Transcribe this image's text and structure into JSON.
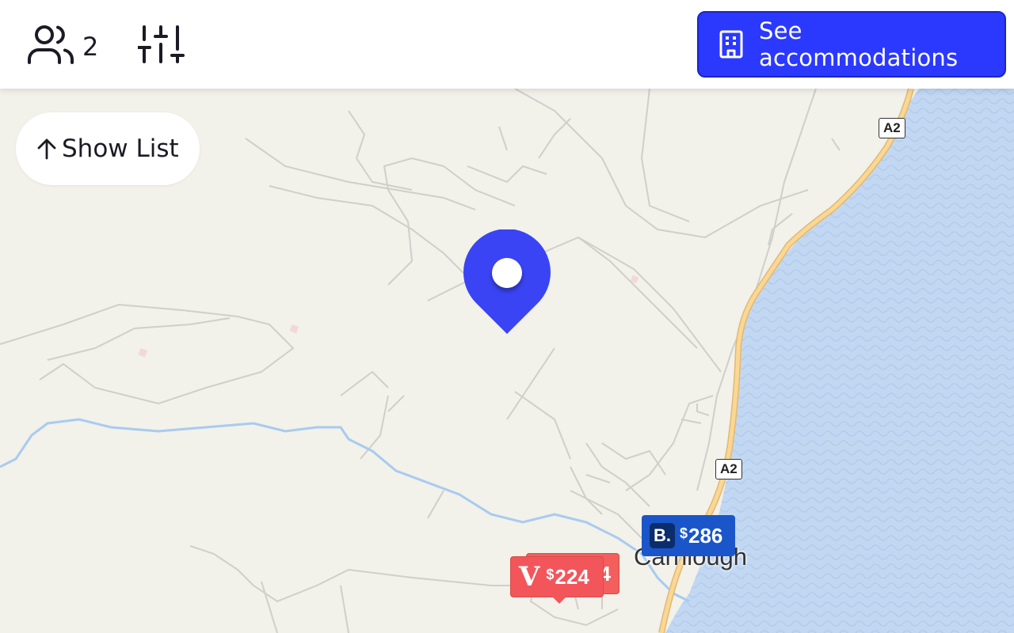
{
  "header": {
    "guests": {
      "icon": "users-icon",
      "count": "2"
    },
    "filters": {
      "icon": "sliders-icon"
    },
    "see_accommodations": {
      "icon": "building-icon",
      "label": "See accommodations"
    }
  },
  "map": {
    "show_list": {
      "icon": "arrow-up-icon",
      "label": "Show List"
    },
    "road_labels": [
      "A2",
      "A2"
    ],
    "place_label": "Carnlough",
    "price_markers": [
      {
        "provider": "booking",
        "logo": "B.",
        "currency": "$",
        "price": "286"
      },
      {
        "provider": "vrbo",
        "logo": "V",
        "currency": "$",
        "price": "224"
      },
      {
        "provider": "vrbo",
        "price_partial": "4"
      }
    ],
    "location_pin": {
      "icon": "map-pin-icon"
    }
  },
  "colors": {
    "accent": "#2b39ff",
    "pin": "#3a44f5",
    "booking": "#1a56c9",
    "vrbo": "#f2565b",
    "water": "#c2d8f2",
    "land": "#f2f1ea",
    "road_major": "#f7d38e"
  }
}
